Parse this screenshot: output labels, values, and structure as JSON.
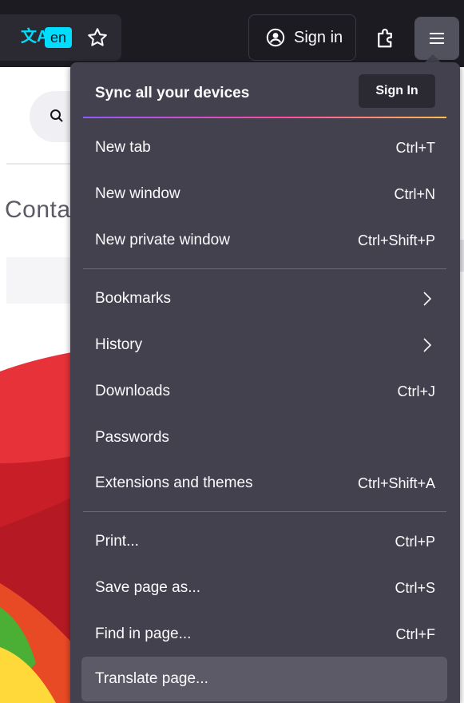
{
  "toolbar": {
    "translate_icon_glyph": "文A",
    "language_badge": "en",
    "sign_in_label": "Sign in"
  },
  "page": {
    "heading_fragment": "Conta"
  },
  "menu": {
    "sync": {
      "title": "Sync all your devices",
      "sign_in_button": "Sign In"
    },
    "items": [
      {
        "label": "New tab",
        "shortcut": "Ctrl+T"
      },
      {
        "label": "New window",
        "shortcut": "Ctrl+N"
      },
      {
        "label": "New private window",
        "shortcut": "Ctrl+Shift+P"
      },
      {
        "label": "Bookmarks",
        "submenu": true
      },
      {
        "label": "History",
        "submenu": true
      },
      {
        "label": "Downloads",
        "shortcut": "Ctrl+J"
      },
      {
        "label": "Passwords"
      },
      {
        "label": "Extensions and themes",
        "shortcut": "Ctrl+Shift+A"
      },
      {
        "label": "Print...",
        "shortcut": "Ctrl+P"
      },
      {
        "label": "Save page as...",
        "shortcut": "Ctrl+S"
      },
      {
        "label": "Find in page...",
        "shortcut": "Ctrl+F"
      },
      {
        "label": "Translate page...",
        "highlighted": true
      }
    ]
  },
  "colors": {
    "toolbar_bg": "#1c1b22",
    "panel_bg": "#42414d",
    "accent_cyan": "#00ddff",
    "hover_bg": "#5b5a66"
  }
}
